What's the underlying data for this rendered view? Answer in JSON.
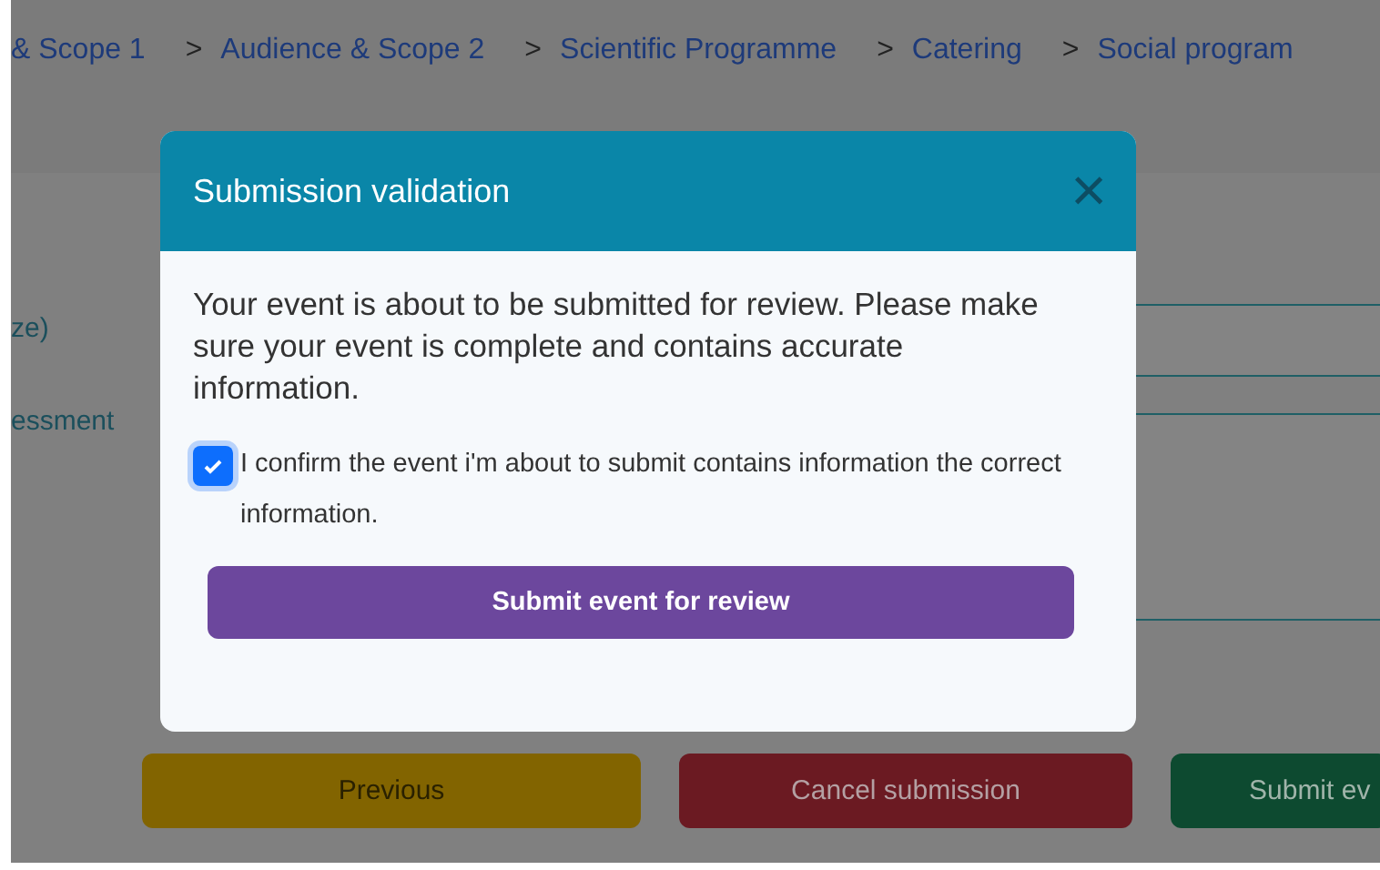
{
  "breadcrumbs": [
    {
      "label": "& Scope 1"
    },
    {
      "label": "Audience & Scope 2"
    },
    {
      "label": "Scientific Programme"
    },
    {
      "label": "Catering"
    },
    {
      "label": "Social program"
    }
  ],
  "separator": ">",
  "form": {
    "labels": [
      "ze)",
      "essment"
    ]
  },
  "footer_buttons": [
    {
      "label": "Previous",
      "kind": "previous"
    },
    {
      "label": "Cancel submission",
      "kind": "cancel"
    },
    {
      "label": "Submit ev",
      "kind": "submit"
    }
  ],
  "dialog": {
    "title": "Submission validation",
    "close": "×",
    "message": "Your event is about to be submitted for review. Please make sure your event is complete and contains accurate information.",
    "confirm": {
      "label": "I confirm the event i'm about to submit contains information the correct information.",
      "checked": true
    },
    "action": "Submit event for review"
  }
}
